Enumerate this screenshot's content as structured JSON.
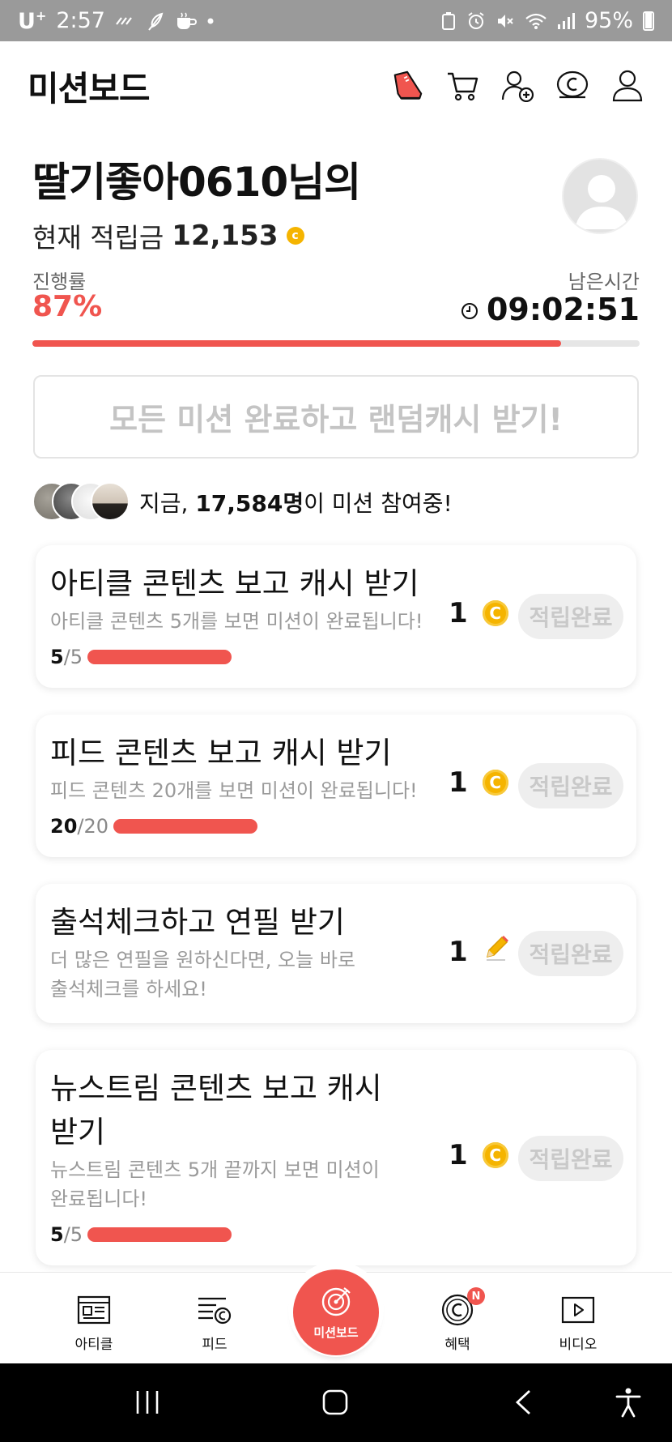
{
  "status_bar": {
    "carrier": "U",
    "carrier_sup": "+",
    "time": "2:57",
    "battery": "95%"
  },
  "app": {
    "title": "미션보드",
    "header_icons": [
      "sneaker-icon",
      "cart-icon",
      "add-friend-icon",
      "cash-icon",
      "profile-icon"
    ]
  },
  "user": {
    "name_line": "딸기좋아0610님의",
    "balance_label": "현재 적립금",
    "balance_value": "12,153",
    "coin_symbol": "c"
  },
  "progress": {
    "label": "진행률",
    "percent_text": "87%",
    "percent_value": 0.87,
    "time_label": "남은시간",
    "time_remaining": "09:02:51"
  },
  "cta": {
    "label": "모든 미션 완료하고 랜덤캐시 받기!"
  },
  "participants": {
    "prefix": "지금, ",
    "count": "17,584명",
    "suffix": "이 미션 참여중!"
  },
  "missions": [
    {
      "title_line1": "아티클 콘텐츠 보고 캐시 받기",
      "title_line2": "",
      "desc_line1": "아티클 콘텐츠 5개를 보면 미션이 완료됩니다!",
      "desc_line2": "",
      "done_count": "5",
      "total_count": "/5",
      "progress": 1.0,
      "reward": "1",
      "reward_icon": "coin-icon",
      "status": "적립완료"
    },
    {
      "title_line1": "피드 콘텐츠 보고 캐시 받기",
      "title_line2": "",
      "desc_line1": "피드 콘텐츠 20개를 보면 미션이 완료됩니다!",
      "desc_line2": "",
      "done_count": "20",
      "total_count": "/20",
      "progress": 1.0,
      "reward": "1",
      "reward_icon": "coin-icon",
      "status": "적립완료"
    },
    {
      "title_line1": "출석체크하고 연필 받기",
      "title_line2": "",
      "desc_line1": "더 많은 연필을 원하신다면, 오늘 바로",
      "desc_line2": "출석체크를 하세요!",
      "reward": "1",
      "reward_icon": "pencil-icon",
      "status": "적립완료"
    },
    {
      "title_line1": "뉴스트림 콘텐츠 보고 캐시",
      "title_line2": "받기",
      "desc_line1": "뉴스트림 콘텐츠 5개 끝까지 보면 미션이",
      "desc_line2": "완료됩니다!",
      "done_count": "5",
      "total_count": "/5",
      "progress": 1.0,
      "reward": "1",
      "reward_icon": "coin-icon",
      "status": "적립완료"
    }
  ],
  "bottom_nav": {
    "article": "아티클",
    "feed": "피드",
    "missionboard": "미션보드",
    "benefit": "혜택",
    "benefit_badge": "N",
    "video": "비디오"
  },
  "colors": {
    "accent": "#f0554f",
    "coin": "#f5b400",
    "muted_text": "#9a9a9a",
    "disabled": "#c9c9c9"
  }
}
